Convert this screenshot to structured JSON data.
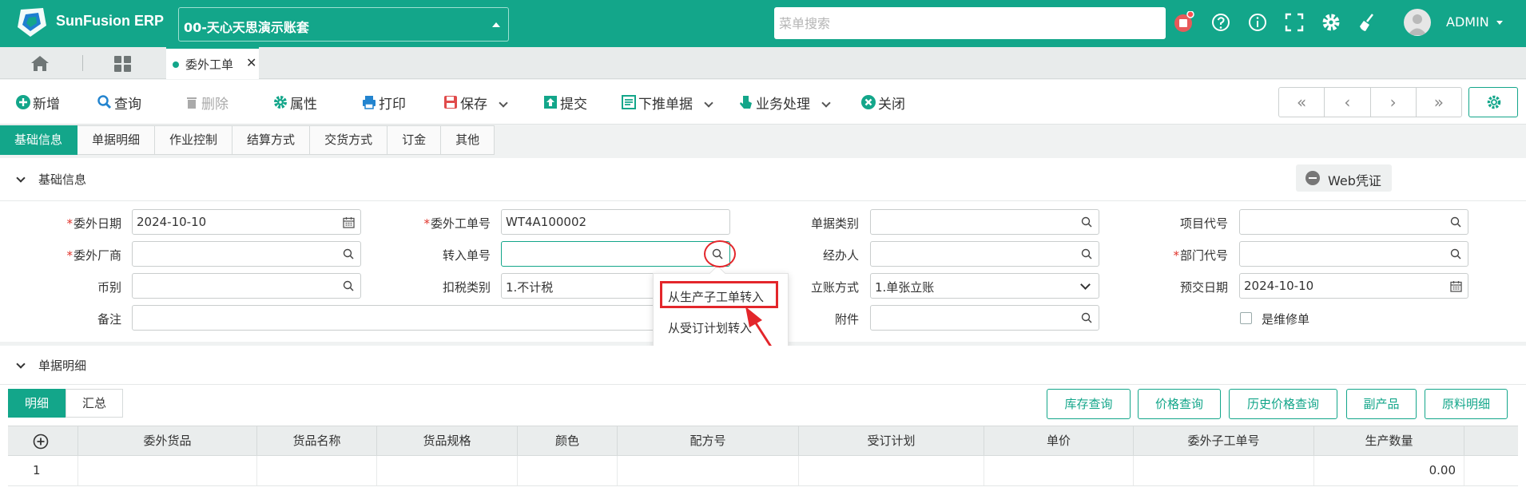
{
  "app": {
    "brand": "SunFusion ERP",
    "account": "00-天心天思演示账套",
    "menu_search_placeholder": "菜单搜索",
    "user": "ADMIN"
  },
  "colors": {
    "primary": "#13a68a",
    "annotation_red": "#e3262b",
    "required": "#e0332b"
  },
  "tabs": {
    "active_doc": "委外工单"
  },
  "toolbar": {
    "new": "新增",
    "query": "查询",
    "delete": "删除",
    "properties": "属性",
    "print": "打印",
    "save": "保存",
    "submit": "提交",
    "push_down": "下推单据",
    "business": "业务处理",
    "close": "关闭",
    "nav": [
      "«",
      "‹",
      "›",
      "»"
    ]
  },
  "section_tabs": [
    "基础信息",
    "单据明细",
    "作业控制",
    "结算方式",
    "交货方式",
    "订金",
    "其他"
  ],
  "basic": {
    "title": "基础信息",
    "web_voucher": "Web凭证",
    "fields": {
      "outsource_date": {
        "label": "委外日期",
        "value": "2024-10-10"
      },
      "outsource_no": {
        "label": "委外工单号",
        "value": "WT4A100002"
      },
      "doc_category": {
        "label": "单据类别",
        "value": ""
      },
      "project_code": {
        "label": "项目代号",
        "value": ""
      },
      "vendor": {
        "label": "委外厂商",
        "value": ""
      },
      "transfer_no": {
        "label": "转入单号",
        "value": ""
      },
      "handler": {
        "label": "经办人",
        "value": ""
      },
      "dept_code": {
        "label": "部门代号",
        "value": ""
      },
      "currency": {
        "label": "币别",
        "value": ""
      },
      "tax_type": {
        "label": "扣税类别",
        "value": "1.不计税"
      },
      "account_method": {
        "label": "立账方式",
        "value": "1.单张立账"
      },
      "delivery_date": {
        "label": "预交日期",
        "value": "2024-10-10"
      },
      "remark": {
        "label": "备注",
        "value": ""
      },
      "attachment": {
        "label": "附件",
        "value": ""
      },
      "is_repair": {
        "label": "是维修单",
        "checked": false
      }
    }
  },
  "transfer_popup": {
    "items": [
      "从生产子工单转入",
      "从受订计划转入"
    ],
    "highlighted_index": 0
  },
  "detail": {
    "title": "单据明细",
    "tabs": [
      "明细",
      "汇总"
    ],
    "buttons": [
      "库存查询",
      "价格查询",
      "历史价格查询",
      "副产品",
      "原料明细"
    ],
    "columns": [
      "委外货品",
      "货品名称",
      "货品规格",
      "颜色",
      "配方号",
      "受订计划",
      "单价",
      "委外子工单号",
      "生产数量"
    ],
    "rows": [
      {
        "no": "1",
        "qty": "0.00"
      }
    ]
  }
}
